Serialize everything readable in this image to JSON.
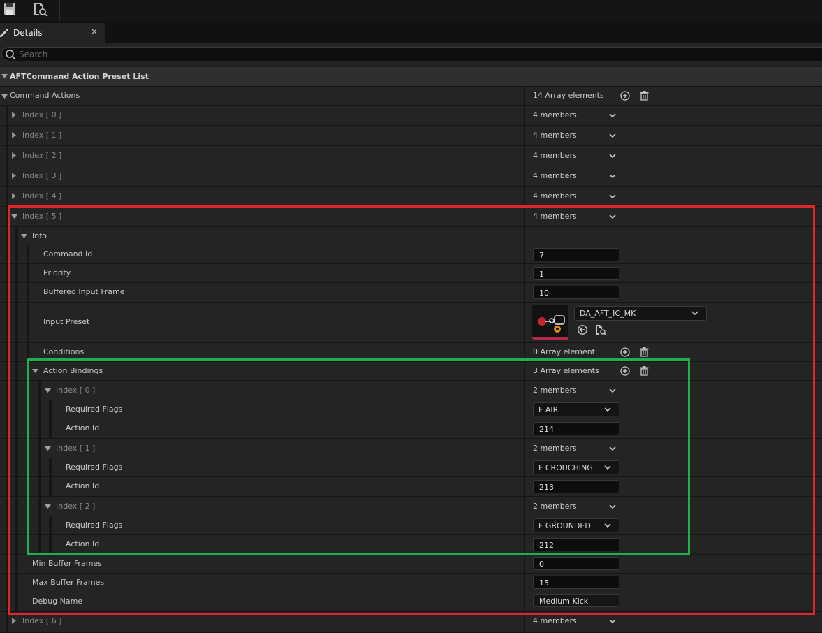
{
  "tab": {
    "title": "Details",
    "close": "×"
  },
  "search": {
    "placeholder": "Search",
    "value": ""
  },
  "category": {
    "title": "AFTCommand Action Preset List"
  },
  "command_actions": {
    "label": "Command Actions",
    "value": "14 Array elements",
    "collapsed_before": [
      {
        "label": "Index [ 0 ]",
        "value": "4 members"
      },
      {
        "label": "Index [ 1 ]",
        "value": "4 members"
      },
      {
        "label": "Index [ 2 ]",
        "value": "4 members"
      },
      {
        "label": "Index [ 3 ]",
        "value": "4 members"
      },
      {
        "label": "Index [ 4 ]",
        "value": "4 members"
      }
    ],
    "expanded": {
      "label": "Index [ 5 ]",
      "value": "4 members",
      "info": {
        "label": "Info",
        "command_id": {
          "label": "Command Id",
          "value": "7"
        },
        "priority": {
          "label": "Priority",
          "value": "1"
        },
        "buffered_input_frame": {
          "label": "Buffered Input Frame",
          "value": "10"
        },
        "input_preset": {
          "label": "Input Preset",
          "value": "DA_AFT_IC_MK"
        },
        "conditions": {
          "label": "Conditions",
          "value": "0 Array element"
        },
        "action_bindings": {
          "label": "Action Bindings",
          "value": "3 Array elements",
          "items": [
            {
              "label": "Index [ 0 ]",
              "value": "2 members",
              "flags_label": "Required Flags",
              "flags": "F AIR",
              "action_label": "Action Id",
              "action_id": "214"
            },
            {
              "label": "Index [ 1 ]",
              "value": "2 members",
              "flags_label": "Required Flags",
              "flags": "F CROUCHING",
              "action_label": "Action Id",
              "action_id": "213"
            },
            {
              "label": "Index [ 2 ]",
              "value": "2 members",
              "flags_label": "Required Flags",
              "flags": "F GROUNDED",
              "action_label": "Action Id",
              "action_id": "212"
            }
          ]
        }
      },
      "min_buffer_frames": {
        "label": "Min Buffer Frames",
        "value": "0"
      },
      "max_buffer_frames": {
        "label": "Max Buffer Frames",
        "value": "15"
      },
      "debug_name": {
        "label": "Debug Name",
        "value": "Medium Kick"
      }
    },
    "collapsed_after": [
      {
        "label": "Index [ 6 ]",
        "value": "4 members"
      }
    ]
  },
  "annotations": {
    "outer_box_color": "#e0262a",
    "inner_box_color": "#1fb04b"
  },
  "icons": [
    "save-icon",
    "find-in-content-browser-icon",
    "details-tab-icon",
    "search-icon",
    "add-element-icon",
    "delete-icon",
    "chevron-down-icon",
    "use-selected-asset-icon",
    "browse-asset-icon"
  ]
}
